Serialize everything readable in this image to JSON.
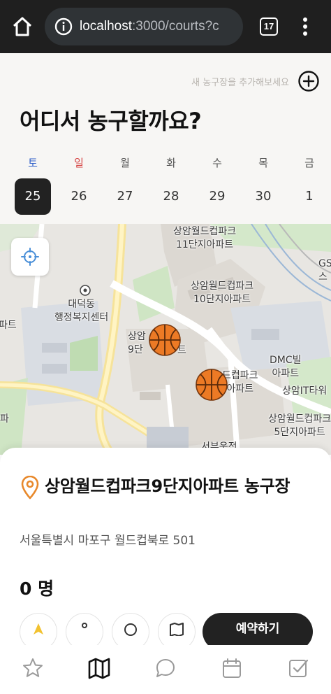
{
  "browser": {
    "url_host": "localhost",
    "url_path": ":3000/courts?c",
    "tab_count": "17"
  },
  "header": {
    "add_hint": "새 농구장을 추가해보세요",
    "title": "어디서 농구할까요?"
  },
  "week": [
    {
      "dow": "토",
      "num": "25",
      "selected": true
    },
    {
      "dow": "일",
      "num": "26"
    },
    {
      "dow": "월",
      "num": "27"
    },
    {
      "dow": "화",
      "num": "28"
    },
    {
      "dow": "수",
      "num": "29"
    },
    {
      "dow": "목",
      "num": "30"
    },
    {
      "dow": "금",
      "num": "1"
    }
  ],
  "map": {
    "labels": {
      "l11_1": "상암월드컵파크",
      "l11_2": "11단지아파트",
      "l10_1": "상암월드컵파크",
      "l10_2": "10단지아파트",
      "daeduk1": "대덕동",
      "daeduk2": "행정복지센터",
      "l9_1": "상암",
      "l9_2": "9단",
      "l9_3": "트",
      "pat": "파트",
      "l8_1": "드컵파크",
      "l8_2": "아파트",
      "dmc1": "DMC빌",
      "dmc2": "아파트",
      "it": "상암IT타워",
      "l5_1": "상암월드컵파크",
      "l5_2": "5단지아파트",
      "gs1": "GS",
      "gs2": "스",
      "seobu": "서부운전",
      "left_pa": "파"
    }
  },
  "court": {
    "name": "상암월드컵파크9단지아파트 농구장",
    "address": "서울특별시 마포구 월드컵북로 501",
    "count": "0 명",
    "reserve_label": "예약하기"
  },
  "colors": {
    "accent": "#e8892c",
    "dark": "#222222",
    "saturday": "#2f5fc9",
    "sunday": "#d64545"
  },
  "nav": [
    "star-icon",
    "map-icon",
    "chat-icon",
    "calendar-icon",
    "checkbox-icon"
  ]
}
